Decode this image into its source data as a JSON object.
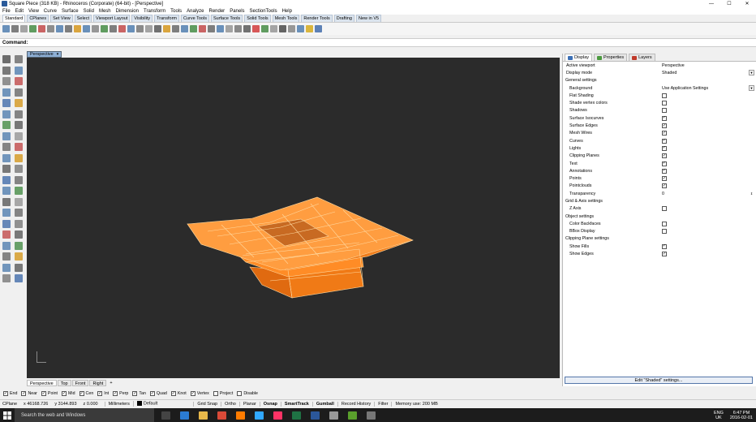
{
  "window": {
    "title": "Square Piece (318 KB) - Rhinoceros (Corporate) (64-bit) - [Perspective]",
    "minimize": "—",
    "maximize": "☐",
    "close": "✕"
  },
  "menu": [
    "File",
    "Edit",
    "View",
    "Curve",
    "Surface",
    "Solid",
    "Mesh",
    "Dimension",
    "Transform",
    "Tools",
    "Analyze",
    "Render",
    "Panels",
    "SectionTools",
    "Help"
  ],
  "toolbar_tabs": [
    "Standard",
    "CPlanes",
    "Set View",
    "Select",
    "Viewport Layout",
    "Visibility",
    "Transform",
    "Curve Tools",
    "Surface Tools",
    "Solid Tools",
    "Mesh Tools",
    "Render Tools",
    "Drafting",
    "New in V5"
  ],
  "toolbar_tabs_active": "Standard",
  "command": {
    "label": "Command:",
    "value": ""
  },
  "viewport": {
    "name": "Perspective",
    "dropdown": "▾",
    "axis_label": "y\nx",
    "tabs": [
      "Perspective",
      "Top",
      "Front",
      "Right"
    ],
    "add_tab": "+"
  },
  "panel": {
    "tabs": [
      {
        "label": "Display",
        "color": "#3b6fb6"
      },
      {
        "label": "Properties",
        "color": "#4b9a3f"
      },
      {
        "label": "Layers",
        "color": "#c03a2b"
      }
    ],
    "rows": [
      {
        "type": "prop",
        "label": "Active viewport",
        "value": "Perspective"
      },
      {
        "type": "prop",
        "label": "Display mode",
        "value": "Shaded",
        "dropdown": true
      },
      {
        "type": "header",
        "label": "General settings"
      },
      {
        "type": "prop",
        "label": "Background",
        "value": "Use Application Settings",
        "dropdown": true,
        "sub": true
      },
      {
        "type": "check",
        "label": "Flat Shading",
        "checked": false
      },
      {
        "type": "check",
        "label": "Shade vertex colors",
        "checked": false
      },
      {
        "type": "check",
        "label": "Shadows",
        "checked": false
      },
      {
        "type": "check",
        "label": "Surface Isocurves",
        "checked": true
      },
      {
        "type": "check",
        "label": "Surface Edges",
        "checked": true
      },
      {
        "type": "check",
        "label": "Mesh Wires",
        "checked": true
      },
      {
        "type": "check",
        "label": "Curves",
        "checked": true
      },
      {
        "type": "check",
        "label": "Lights",
        "checked": true
      },
      {
        "type": "check",
        "label": "Clipping Planes",
        "checked": true
      },
      {
        "type": "check",
        "label": "Text",
        "checked": true
      },
      {
        "type": "check",
        "label": "Annotations",
        "checked": true
      },
      {
        "type": "check",
        "label": "Points",
        "checked": true
      },
      {
        "type": "check",
        "label": "Pointclouds",
        "checked": true
      },
      {
        "type": "prop",
        "label": "Transparency",
        "value": "0",
        "spinner": true,
        "sub": true
      },
      {
        "type": "header",
        "label": "Grid & Axis settings"
      },
      {
        "type": "check",
        "label": "Z Axis",
        "checked": false
      },
      {
        "type": "header",
        "label": "Object settings"
      },
      {
        "type": "check",
        "label": "Color Backfaces",
        "checked": false
      },
      {
        "type": "check",
        "label": "BBox Display",
        "checked": false
      },
      {
        "type": "header",
        "label": "Clipping Plane settings"
      },
      {
        "type": "check",
        "label": "Show Fills",
        "checked": true
      },
      {
        "type": "check",
        "label": "Show Edges",
        "checked": true
      }
    ],
    "edit_button": "Edit \"Shaded\" settings..."
  },
  "osnaps": [
    {
      "label": "End",
      "checked": true
    },
    {
      "label": "Near",
      "checked": true
    },
    {
      "label": "Point",
      "checked": true
    },
    {
      "label": "Mid",
      "checked": true
    },
    {
      "label": "Cen",
      "checked": true
    },
    {
      "label": "Int",
      "checked": true
    },
    {
      "label": "Perp",
      "checked": true
    },
    {
      "label": "Tan",
      "checked": true
    },
    {
      "label": "Quad",
      "checked": true
    },
    {
      "label": "Knot",
      "checked": true
    },
    {
      "label": "Vertex",
      "checked": true
    },
    {
      "label": "Project",
      "checked": false
    },
    {
      "label": "Disable",
      "checked": false
    }
  ],
  "status": {
    "cplane": "CPlane",
    "x": "x 46168.726",
    "y": "y 3144.893",
    "z": "z 0.000",
    "units": "Millimeters",
    "layer": "Default",
    "toggles": [
      "Grid Snap",
      "Ortho",
      "Planar",
      "Osnap",
      "SmartTrack",
      "Gumball",
      "Record History",
      "Filter"
    ],
    "bold_toggles": [
      "Osnap",
      "SmartTrack",
      "Gumball"
    ],
    "memory": "Memory use: 200 MB"
  },
  "taskbar": {
    "search": "Search the web and Windows",
    "apps": [
      {
        "name": "task-view",
        "color": "#444"
      },
      {
        "name": "edge",
        "color": "#2b7cd3"
      },
      {
        "name": "file-explorer",
        "color": "#e8b84a"
      },
      {
        "name": "chrome",
        "color": "#d94a38"
      },
      {
        "name": "illustrator",
        "color": "#ff7c00"
      },
      {
        "name": "photoshop",
        "color": "#31a8ff"
      },
      {
        "name": "indesign",
        "color": "#ff3366"
      },
      {
        "name": "excel",
        "color": "#1f7244"
      },
      {
        "name": "word",
        "color": "#2b579a"
      },
      {
        "name": "rhino",
        "color": "#999"
      },
      {
        "name": "app-green",
        "color": "#5aa02c"
      },
      {
        "name": "app-gray",
        "color": "#777"
      }
    ],
    "lang": "ENG",
    "region": "UK",
    "time": "6:47 PM",
    "date": "2016-02-01"
  }
}
